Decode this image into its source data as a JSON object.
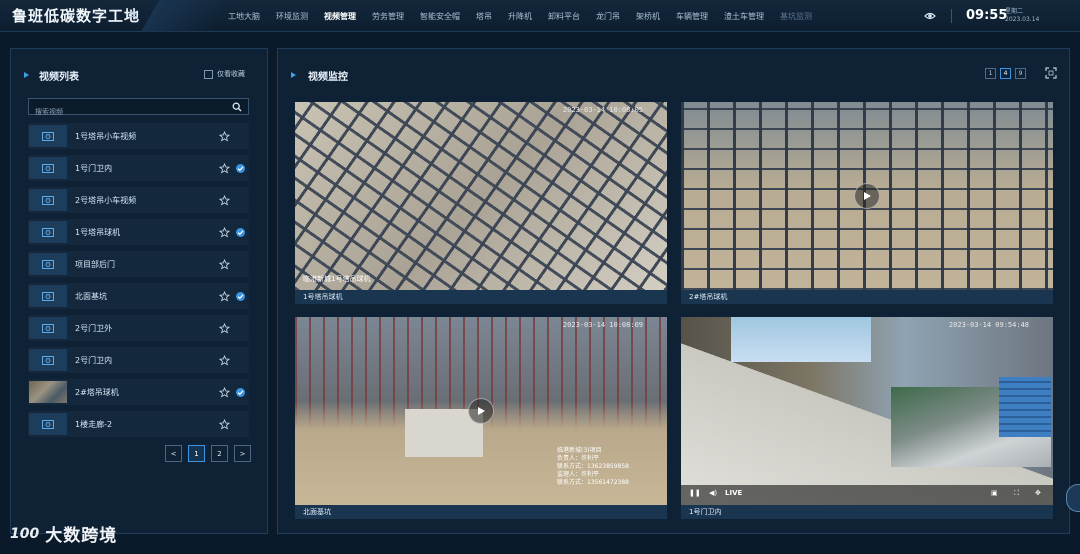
{
  "header": {
    "brand": "鲁班低碳数字工地",
    "nav": [
      "工地大脑",
      "环境监测",
      "视频管理",
      "劳务管理",
      "智能安全帽",
      "塔吊",
      "升降机",
      "卸料平台",
      "龙门吊",
      "架桥机",
      "车辆管理",
      "渣土车管理",
      "基坑监测"
    ],
    "active_nav": "视频管理",
    "time": "09:55",
    "weekday": "星期二",
    "date": "2023.03.14"
  },
  "sidebar": {
    "title": "视频列表",
    "fav_label": "仅看收藏",
    "search_placeholder": "搜索视频",
    "items": [
      {
        "label": "1号塔吊小车视频",
        "fav": false
      },
      {
        "label": "1号门卫内",
        "fav": true
      },
      {
        "label": "2号塔吊小车视频",
        "fav": false
      },
      {
        "label": "1号塔吊球机",
        "fav": true
      },
      {
        "label": "项目部后门",
        "fav": false
      },
      {
        "label": "北面基坑",
        "fav": true
      },
      {
        "label": "2号门卫外",
        "fav": false
      },
      {
        "label": "2号门卫内",
        "fav": false
      },
      {
        "label": "2#塔吊球机",
        "fav": true
      },
      {
        "label": "1楼走廊-2",
        "fav": false
      }
    ],
    "pager": {
      "prev": "<",
      "pages": [
        "1",
        "2"
      ],
      "current": "1",
      "next": ">"
    }
  },
  "main": {
    "title": "视频监控",
    "layouts": [
      "1",
      "4",
      "9"
    ],
    "active_layout": "4",
    "tiles": [
      {
        "caption": "1号塔吊球机",
        "timestamp": "2023-03-14 10:08:05",
        "osd": "临港新城1号塔吊球机"
      },
      {
        "caption": "2#塔吊球机",
        "timestamp": "",
        "osd": ""
      },
      {
        "caption": "北面基坑",
        "timestamp": "2023-03-14 10:08:09",
        "osd": "临港新城(3)项目\n负责人：许利平\n联系方式：13623859858\n监理人：许利平\n联系方式：13561472388"
      },
      {
        "caption": "1号门卫内",
        "timestamp": "2023-03-14 09:54:48",
        "live": "LIVE"
      }
    ]
  },
  "watermark": {
    "logo": "100",
    "text": "大数跨境"
  }
}
